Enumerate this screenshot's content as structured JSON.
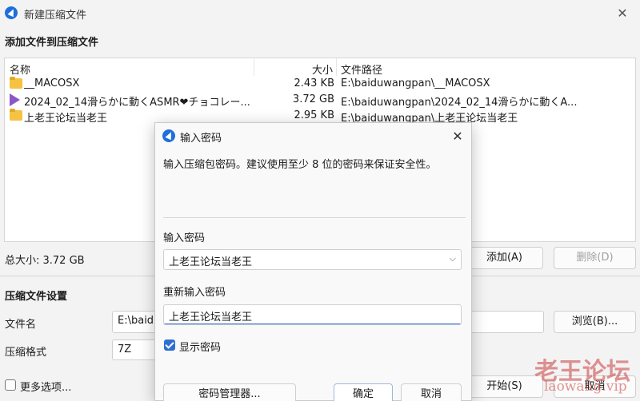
{
  "window": {
    "title": "新建压缩文件",
    "close_glyph": "✕"
  },
  "add_section": {
    "heading": "添加文件到压缩文件"
  },
  "table": {
    "headers": {
      "name": "名称",
      "size": "大小",
      "path": "文件路径"
    },
    "rows": [
      {
        "icon": "folder-icon",
        "name": "__MACOSX",
        "size": "2.43 KB",
        "path": "E:\\baiduwangpan\\__MACOSX"
      },
      {
        "icon": "video-icon",
        "name": "2024_02_14滑らかに動くASMR❤チョコレー...",
        "size": "3.72 GB",
        "path": "E:\\baiduwangpan\\2024_02_14滑らかに動くA..."
      },
      {
        "icon": "folder-icon",
        "name": "上老王论坛当老王",
        "size": "2.95 KB",
        "path": "E:\\baiduwangpan\\上老王论坛当老王"
      }
    ]
  },
  "summary": {
    "total_size": "总大小: 3.72 GB",
    "add_button": "添加(A)",
    "delete_button": "删除(D)"
  },
  "settings": {
    "heading": "压缩文件设置",
    "filename_label": "文件名",
    "filename_value": "E:\\baidu",
    "browse_button": "浏览(B)...",
    "format_label": "压缩格式",
    "format_value": "7Z",
    "more_options": "更多选项...",
    "start_button": "开始(S)",
    "cancel_button": "取消"
  },
  "dialog": {
    "title": "输入密码",
    "close_glyph": "✕",
    "description": "输入压缩包密码。建议使用至少 8 位的密码来保证安全性。",
    "password_label": "输入密码",
    "password_value": "上老王论坛当老王",
    "dropdown_arrow": "⌵",
    "reenter_label": "重新输入密码",
    "reenter_value": "上老王论坛当老王",
    "show_password_label": "显示密码",
    "show_password_checked": true,
    "manager_button": "密码管理器...",
    "ok_button": "确定",
    "cancel_button": "取消"
  },
  "watermark": {
    "text": "老王论坛",
    "subtext": "laowang.vip"
  },
  "colors": {
    "accent": "#2f6fd0",
    "app_icon": "#1e6fd9",
    "folder": "#f5c242",
    "video": "#8a57c7"
  }
}
